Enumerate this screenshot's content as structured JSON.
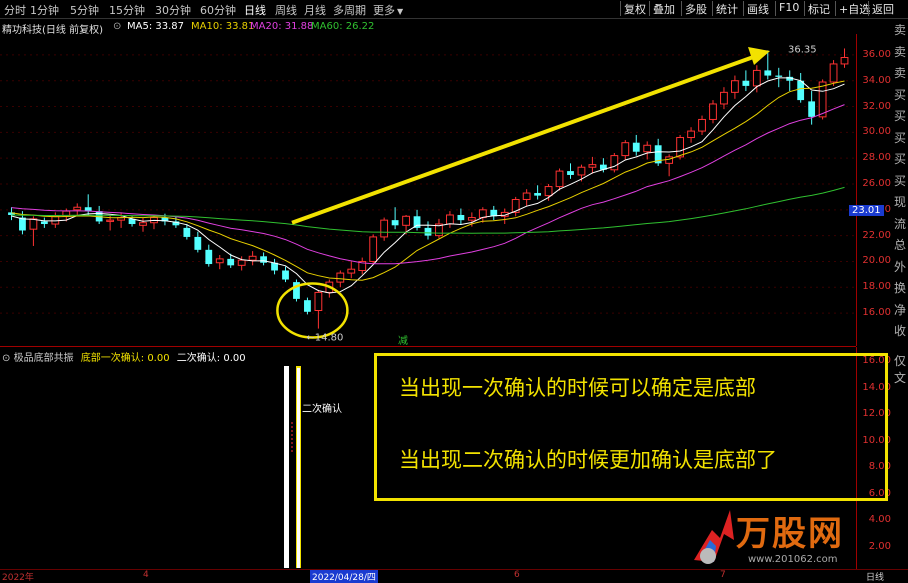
{
  "periods": {
    "items": [
      "分时",
      "1分钟",
      "5分钟",
      "15分钟",
      "30分钟",
      "60分钟",
      "日线",
      "周线",
      "月线",
      "多周期",
      "更多"
    ],
    "active": "日线",
    "more_icon": "chevron-down-icon"
  },
  "right_buttons": [
    "复权",
    "叠加",
    "多股",
    "统计",
    "画线",
    "F10",
    "标记",
    "+自选",
    "返回"
  ],
  "info": {
    "title": "精功科技(日线 前复权)",
    "ma5": "MA5: 33.87",
    "ma10": "MA10: 33.81",
    "ma20": "MA20: 31.88",
    "ma60": "MA60: 26.22",
    "colors": {
      "ma5": "#ffffff",
      "ma10": "#e8d000",
      "ma20": "#e040e0",
      "ma60": "#30c030"
    }
  },
  "price_axis": [
    "36.00",
    "34.00",
    "32.00",
    "30.00",
    "28.00",
    "26.00",
    "24.00",
    "22.00",
    "20.00",
    "18.00",
    "16.00"
  ],
  "current_price": "23.01",
  "annotations": {
    "high": "36.35",
    "low": "←14.80",
    "mark": "减"
  },
  "side_glyphs": [
    "卖",
    "卖",
    "卖",
    "买",
    "买",
    "买",
    "买",
    "买",
    "现",
    "流",
    "总",
    "外",
    "换",
    "净",
    "收"
  ],
  "sub": {
    "indicator": "极品底部共振",
    "first_label": "底部一次确认: 0.00",
    "second_label": "二次确认: 0.00",
    "second_text": "二次确认",
    "axis": [
      "16.00",
      "14.00",
      "12.00",
      "10.00",
      "8.00",
      "6.00",
      "4.00",
      "2.00"
    ],
    "side": [
      "仅",
      "文"
    ]
  },
  "notes": {
    "line1": "当出现一次确认的时候可以确定是底部",
    "line2": "当出现二次确认的时候更加确认是底部了"
  },
  "bottom_axis": {
    "labels": [
      "2022年",
      "4",
      "2022/04/28/四",
      "6",
      "7"
    ],
    "right": "日线"
  },
  "logo": {
    "text": "万股网",
    "url": "www.201062.com"
  },
  "chart_data": {
    "type": "candlestick",
    "title": "精功科技(日线 前复权)",
    "ylim": [
      15,
      37
    ],
    "y_ticks": [
      16,
      18,
      20,
      22,
      24,
      26,
      28,
      30,
      32,
      34,
      36
    ],
    "series": [
      {
        "name": "K线",
        "ohlc": [
          [
            23.8,
            24.2,
            23.2,
            23.6
          ],
          [
            23.4,
            23.9,
            22.1,
            22.4
          ],
          [
            22.5,
            23.5,
            21.2,
            23.3
          ],
          [
            23.1,
            23.4,
            22.6,
            22.9
          ],
          [
            22.9,
            23.8,
            22.6,
            23.5
          ],
          [
            23.5,
            24.1,
            23.1,
            23.9
          ],
          [
            24.0,
            24.5,
            23.6,
            24.2
          ],
          [
            24.2,
            25.2,
            23.6,
            23.9
          ],
          [
            23.9,
            24.3,
            22.9,
            23.1
          ],
          [
            23.1,
            23.6,
            22.4,
            23.2
          ],
          [
            23.2,
            23.8,
            22.6,
            23.4
          ],
          [
            23.3,
            23.5,
            22.7,
            22.9
          ],
          [
            22.8,
            23.4,
            22.3,
            23.0
          ],
          [
            23.0,
            23.6,
            22.5,
            23.4
          ],
          [
            23.4,
            23.7,
            22.8,
            23.1
          ],
          [
            23.1,
            23.5,
            22.6,
            22.8
          ],
          [
            22.6,
            22.9,
            21.7,
            21.9
          ],
          [
            21.9,
            22.3,
            20.7,
            20.9
          ],
          [
            20.9,
            21.3,
            19.6,
            19.8
          ],
          [
            19.9,
            20.5,
            19.4,
            20.2
          ],
          [
            20.2,
            20.6,
            19.5,
            19.7
          ],
          [
            19.7,
            20.4,
            19.3,
            20.1
          ],
          [
            20.1,
            20.8,
            19.7,
            20.4
          ],
          [
            20.4,
            20.7,
            19.7,
            19.9
          ],
          [
            19.9,
            20.2,
            19.0,
            19.3
          ],
          [
            19.3,
            19.6,
            18.4,
            18.6
          ],
          [
            18.4,
            18.6,
            16.9,
            17.1
          ],
          [
            17.0,
            17.2,
            15.9,
            16.1
          ],
          [
            16.2,
            17.8,
            14.8,
            17.6
          ],
          [
            17.6,
            18.6,
            17.2,
            18.4
          ],
          [
            18.4,
            19.3,
            18.0,
            19.1
          ],
          [
            19.1,
            20.0,
            18.7,
            19.4
          ],
          [
            19.3,
            20.3,
            19.0,
            20.0
          ],
          [
            20.0,
            22.1,
            19.8,
            21.9
          ],
          [
            21.9,
            23.4,
            21.6,
            23.2
          ],
          [
            23.2,
            24.2,
            22.5,
            22.8
          ],
          [
            22.8,
            23.6,
            22.1,
            23.5
          ],
          [
            23.5,
            24.0,
            22.4,
            22.6
          ],
          [
            22.6,
            23.1,
            21.7,
            22.0
          ],
          [
            22.0,
            23.3,
            21.8,
            22.9
          ],
          [
            22.9,
            23.9,
            22.6,
            23.6
          ],
          [
            23.6,
            24.1,
            22.9,
            23.2
          ],
          [
            23.2,
            23.8,
            22.7,
            23.4
          ],
          [
            23.4,
            24.2,
            23.0,
            24.0
          ],
          [
            24.0,
            24.3,
            23.2,
            23.5
          ],
          [
            23.5,
            24.1,
            22.9,
            23.8
          ],
          [
            23.8,
            25.0,
            23.5,
            24.8
          ],
          [
            24.8,
            25.6,
            24.3,
            25.3
          ],
          [
            25.3,
            25.9,
            24.8,
            25.1
          ],
          [
            25.1,
            26.0,
            24.7,
            25.8
          ],
          [
            25.8,
            27.2,
            25.5,
            27.0
          ],
          [
            27.0,
            27.6,
            26.4,
            26.7
          ],
          [
            26.7,
            27.5,
            26.2,
            27.3
          ],
          [
            27.3,
            28.1,
            26.8,
            27.5
          ],
          [
            27.5,
            28.0,
            26.9,
            27.1
          ],
          [
            27.1,
            28.4,
            26.9,
            28.2
          ],
          [
            28.2,
            29.4,
            27.9,
            29.2
          ],
          [
            29.2,
            29.8,
            28.2,
            28.5
          ],
          [
            28.5,
            29.3,
            27.9,
            29.0
          ],
          [
            29.0,
            29.5,
            27.4,
            27.6
          ],
          [
            27.6,
            28.3,
            26.6,
            28.1
          ],
          [
            28.1,
            29.8,
            27.9,
            29.6
          ],
          [
            29.6,
            30.4,
            29.2,
            30.1
          ],
          [
            30.1,
            31.3,
            29.8,
            31.0
          ],
          [
            31.0,
            32.5,
            30.7,
            32.2
          ],
          [
            32.2,
            33.5,
            31.8,
            33.1
          ],
          [
            33.1,
            34.4,
            32.6,
            34.0
          ],
          [
            34.0,
            34.8,
            33.2,
            33.6
          ],
          [
            33.6,
            35.2,
            33.1,
            34.8
          ],
          [
            34.8,
            36.35,
            34.1,
            34.4
          ],
          [
            34.4,
            35.0,
            33.5,
            34.3
          ],
          [
            34.3,
            34.8,
            33.2,
            34.0
          ],
          [
            34.0,
            34.6,
            32.3,
            32.5
          ],
          [
            32.4,
            33.2,
            30.6,
            31.2
          ],
          [
            31.2,
            34.1,
            31.0,
            33.9
          ],
          [
            33.9,
            35.6,
            33.6,
            35.3
          ],
          [
            35.3,
            36.5,
            35.0,
            35.8
          ]
        ]
      }
    ]
  }
}
